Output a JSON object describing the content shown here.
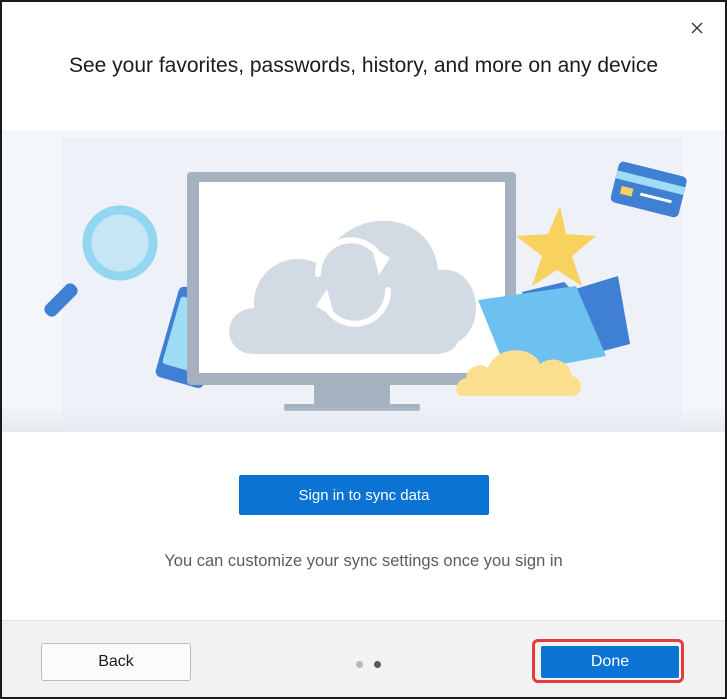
{
  "dialog": {
    "title": "See your favorites, passwords, history, and more on any device",
    "close_icon": "close-icon",
    "illustration_icon": "sync-illustration"
  },
  "sync": {
    "sign_in_label": "Sign in to sync data",
    "hint": "You can customize your sync settings once you sign in"
  },
  "footer": {
    "back_label": "Back",
    "done_label": "Done",
    "pages": {
      "total": 2,
      "current": 2
    }
  },
  "colors": {
    "accent": "#0a73d4",
    "highlight": "#e43b3f"
  }
}
